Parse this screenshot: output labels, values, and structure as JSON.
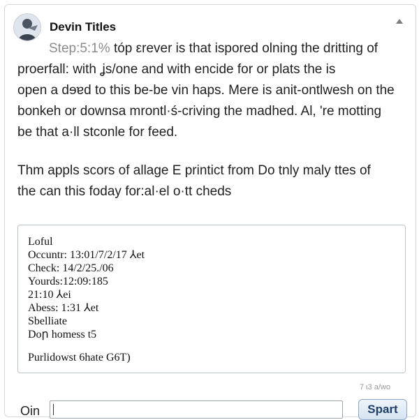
{
  "header": {
    "title": "Devin Titles"
  },
  "content": {
    "step_label": "Step:5:1%",
    "paragraph1_first": " tóp εrever is that ispored olning the dritting of",
    "paragraph1_lines": [
      "proerfall: with ʝs/one and with encide for or plats the is",
      "open a dɘɐd to this be-be vin haps. Mere is anit-ontlwesh on the",
      "bonkeh or downsa mrontl·ś-criving the madhed. Al, 're motting",
      "be that a·ll stconle for feed."
    ],
    "paragraph2_lines": [
      "Thm appls scors of allage E printict from Do tnly maly ttes of",
      "the can this foday for:al·el o·tt cheds"
    ]
  },
  "log": {
    "lines": [
      "Loful",
      "Occuntr: 13:01/7/2/17 ⅄et",
      "Check: 14/2/25./06",
      "Yourds:12:09:185",
      "21:10 ⅄ei",
      "Abess: 1:31 ⅄et",
      "Sbelliate",
      "Doր homess t5"
    ],
    "footer": "Purlidowst 6hate G6T)"
  },
  "counter": "7 ɩ3 a/wo",
  "composer": {
    "label": "Oin",
    "input_value": "",
    "send_label": "Spart"
  },
  "colors": {
    "button_border": "#8aa8c8",
    "button_text": "#1f3f66",
    "box_border": "#b9c3cf"
  }
}
